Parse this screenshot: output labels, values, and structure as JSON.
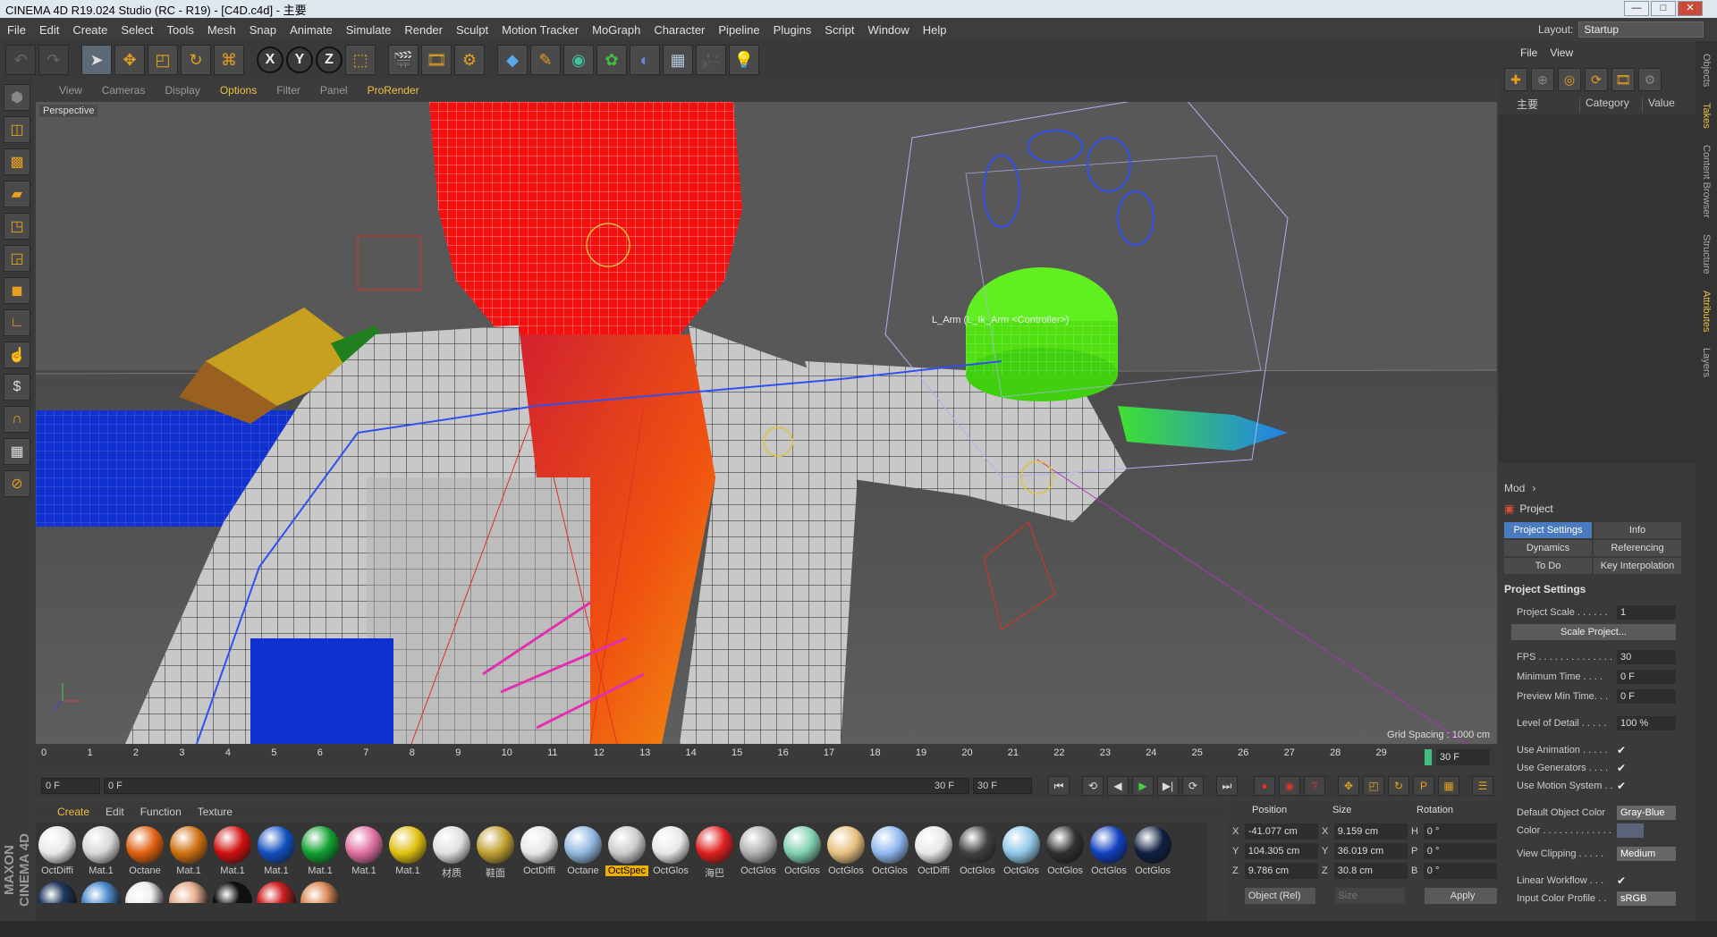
{
  "window": {
    "title": "CINEMA 4D R19.024 Studio (RC - R19) - [C4D.c4d] - 主要",
    "controls": [
      "—",
      "□",
      "✕"
    ]
  },
  "menubar": [
    "File",
    "Edit",
    "Create",
    "Select",
    "Tools",
    "Mesh",
    "Snap",
    "Animate",
    "Simulate",
    "Render",
    "Sculpt",
    "Motion Tracker",
    "MoGraph",
    "Character",
    "Pipeline",
    "Plugins",
    "Script",
    "Window",
    "Help"
  ],
  "layout": {
    "label": "Layout:",
    "value": "Startup"
  },
  "viewport_menu": {
    "items": [
      "View",
      "Cameras",
      "Display",
      "Options",
      "Filter",
      "Panel"
    ],
    "active": "Options",
    "prorender": "ProRender"
  },
  "viewport": {
    "camera": "Perspective",
    "grid_spacing": "Grid Spacing : 1000 cm",
    "arm_label": "L_Arm (L_Ik_Arm <Controller>)"
  },
  "timeline": {
    "ticks": [
      "0",
      "1",
      "2",
      "3",
      "4",
      "5",
      "6",
      "7",
      "8",
      "9",
      "10",
      "11",
      "12",
      "13",
      "14",
      "15",
      "16",
      "17",
      "18",
      "19",
      "20",
      "21",
      "22",
      "23",
      "24",
      "25",
      "26",
      "27",
      "28",
      "29"
    ],
    "end": "30 F"
  },
  "playbar": {
    "start": "0 F",
    "range_start": "0 F",
    "range_end": "30 F",
    "max": "30 F"
  },
  "material_menu": {
    "items": [
      "Create",
      "Edit",
      "Function",
      "Texture"
    ],
    "active": "Create"
  },
  "materials": [
    {
      "name": "OctDiffi",
      "color": "#e8e8e8"
    },
    {
      "name": "Mat.1",
      "color": "#d8d8d8"
    },
    {
      "name": "Octane",
      "color": "#e06010"
    },
    {
      "name": "Mat.1",
      "color": "#d07010"
    },
    {
      "name": "Mat.1",
      "color": "#d01010"
    },
    {
      "name": "Mat.1",
      "color": "#1050c0"
    },
    {
      "name": "Mat.1",
      "color": "#10a030"
    },
    {
      "name": "Mat.1",
      "color": "#e070a0"
    },
    {
      "name": "Mat.1",
      "color": "#e0c010"
    },
    {
      "name": "材质",
      "color": "#e0e0e0"
    },
    {
      "name": "鞋面",
      "color": "#c0a030"
    },
    {
      "name": "OctDiffi",
      "color": "#e8e8e8"
    },
    {
      "name": "Octane",
      "color": "#90b8e0"
    },
    {
      "name": "OctSpec",
      "color": "#cccccc",
      "selected": true
    },
    {
      "name": "OctGlos",
      "color": "#e8e8e8"
    },
    {
      "name": "海巴",
      "color": "#e02020"
    },
    {
      "name": "OctGlos",
      "color": "#b0b0b0"
    },
    {
      "name": "OctGlos",
      "color": "#80d0b0"
    },
    {
      "name": "OctGlos",
      "color": "#e8c080"
    },
    {
      "name": "OctGlos",
      "color": "#90b8f0"
    },
    {
      "name": "OctDiffi",
      "color": "#e8e8e8"
    },
    {
      "name": "OctGlos",
      "color": "#404040"
    },
    {
      "name": "OctGlos",
      "color": "#90c8e8"
    },
    {
      "name": "OctGlos",
      "color": "#303030"
    },
    {
      "name": "OctGlos",
      "color": "#1040c0"
    },
    {
      "name": "OctGlos",
      "color": "#102040"
    }
  ],
  "materials_row2": [
    "#203860",
    "#5090d0",
    "#f0f0f0",
    "#e8b090",
    "#101010",
    "#d02020",
    "#e09060"
  ],
  "coords": {
    "headers": [
      "Position",
      "Size",
      "Rotation"
    ],
    "rows": [
      {
        "axis": "X",
        "pos": "-41.077 cm",
        "saxis": "X",
        "size": "9.159 cm",
        "raxis": "H",
        "rot": "0 °"
      },
      {
        "axis": "Y",
        "pos": "104.305 cm",
        "saxis": "Y",
        "size": "36.019 cm",
        "raxis": "P",
        "rot": "0 °"
      },
      {
        "axis": "Z",
        "pos": "9.786 cm",
        "saxis": "Z",
        "size": "30.8 cm",
        "raxis": "B",
        "rot": "0 °"
      }
    ],
    "mode": "Object (Rel)",
    "size_mode": "Size",
    "apply": "Apply"
  },
  "objects": {
    "menu": [
      "File",
      "View"
    ],
    "take": "主要",
    "columns": [
      "Category",
      "Value"
    ]
  },
  "attributes": {
    "mode": "Mod",
    "title": "Project",
    "tabs": [
      {
        "label": "Project Settings",
        "active": true
      },
      {
        "label": "Info"
      },
      {
        "label": "Dynamics"
      },
      {
        "label": "Referencing"
      },
      {
        "label": "To Do"
      },
      {
        "label": "Key Interpolation"
      }
    ],
    "section": "Project Settings",
    "project_scale": {
      "label": "Project Scale . . . . . .",
      "value": "1"
    },
    "scale_button": "Scale Project...",
    "fps": {
      "label": "FPS . . . . . . . . . . . . . .",
      "value": "30"
    },
    "min_time": {
      "label": "Minimum Time . . . .",
      "value": "0 F"
    },
    "preview_min": {
      "label": "Preview Min Time. . .",
      "value": "0 F"
    },
    "lod": {
      "label": "Level of Detail . . . . .",
      "value": "100 %"
    },
    "use_animation": {
      "label": "Use Animation . . . . .",
      "value": "✔"
    },
    "use_generators": {
      "label": "Use Generators . . . .",
      "value": "✔"
    },
    "use_motion": {
      "label": "Use Motion System . .",
      "value": "✔"
    },
    "default_color": {
      "label": "Default Object Color",
      "value": "Gray-Blue"
    },
    "color": {
      "label": "Color . . . . . . . . . . . . .",
      "value": ""
    },
    "view_clipping": {
      "label": "View Clipping . . . . .",
      "value": "Medium"
    },
    "linear_workflow": {
      "label": "Linear Workflow . . .",
      "value": "✔"
    },
    "input_color_profile": {
      "label": "Input Color Profile . .",
      "value": "sRGB"
    }
  },
  "side_tabs": [
    {
      "label": "Objects"
    },
    {
      "label": "Takes",
      "active": true
    },
    {
      "label": "Content Browser"
    },
    {
      "label": "Structure"
    },
    {
      "label": "Attributes",
      "active": true
    },
    {
      "label": "Layers"
    }
  ],
  "logo": "MAXON CINEMA 4D"
}
